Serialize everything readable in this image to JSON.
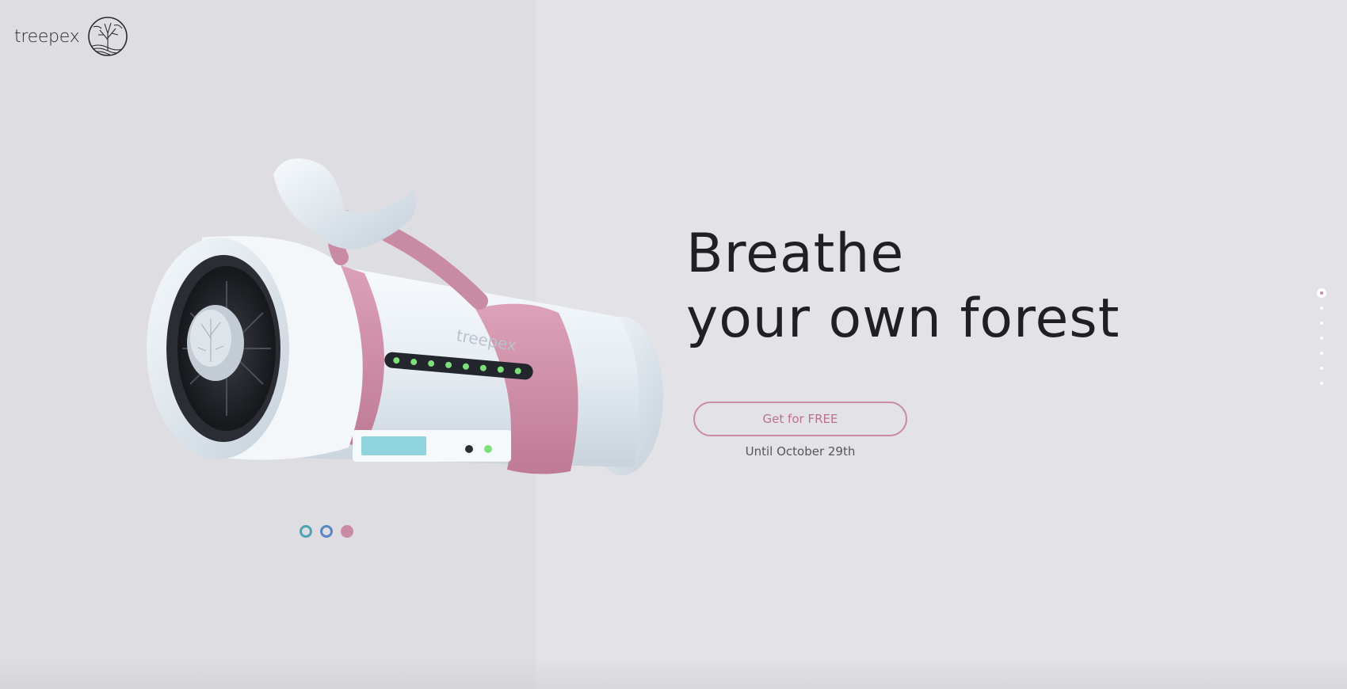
{
  "brand": {
    "name": "treepex",
    "logo_icon": "tree-emblem-icon",
    "device_label": "treepex"
  },
  "hero": {
    "headline_line1": "Breathe",
    "headline_line2": "your own forest",
    "cta_label": "Get for FREE",
    "cta_note": "Until October 29th"
  },
  "carousel": {
    "slides": [
      {
        "name": "slide-1",
        "color": "#4fa3b3",
        "active": false
      },
      {
        "name": "slide-2",
        "color": "#5b86c4",
        "active": false
      },
      {
        "name": "slide-3",
        "color": "#c98aa4",
        "active": true
      }
    ]
  },
  "side_nav": {
    "sections": 7,
    "active_index": 0
  },
  "colors": {
    "accent_pink": "#c98aa4",
    "device_white": "#eef3f7",
    "led_green": "#7ee07a",
    "background": "#e3e3e7",
    "left_panel": "#dedde1"
  }
}
